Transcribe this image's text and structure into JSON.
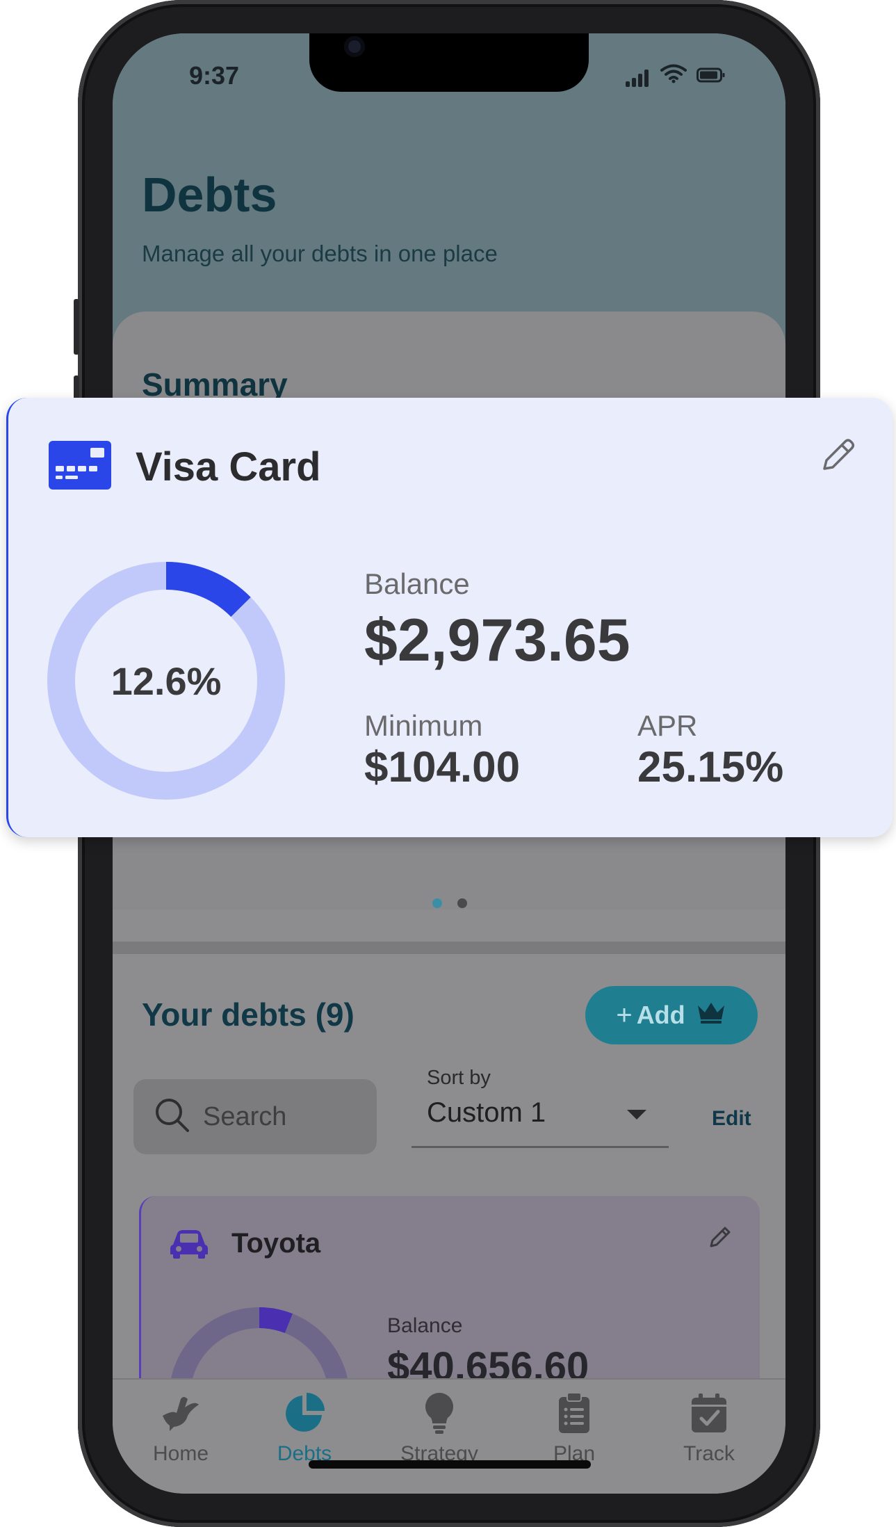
{
  "status": {
    "time": "9:37"
  },
  "header": {
    "title": "Debts",
    "subtitle": "Manage all your debts in one place"
  },
  "summary": {
    "title": "Summary",
    "carousel_pages": 2,
    "active_page": 1
  },
  "visa_card": {
    "name": "Visa Card",
    "icon": "credit-card-icon",
    "percent_label": "12.6%",
    "percent_value": 12.6,
    "balance_label": "Balance",
    "balance": "$2,973.65",
    "minimum_label": "Minimum",
    "minimum": "$104.00",
    "apr_label": "APR",
    "apr": "25.15%",
    "accent_color": "#2a46e8",
    "track_color": "#c0c9fa"
  },
  "debts_list": {
    "title": "Your debts (9)",
    "add_label": "Add",
    "search_placeholder": "Search",
    "sort_label": "Sort by",
    "sort_value": "Custom 1",
    "edit_label": "Edit",
    "items": [
      {
        "name": "Toyota",
        "icon": "car-icon",
        "balance_label": "Balance",
        "balance": "$40,656.60",
        "percent_value": 6
      }
    ]
  },
  "tabbar": {
    "items": [
      {
        "label": "Home",
        "icon": "dove-icon"
      },
      {
        "label": "Debts",
        "icon": "pie-chart-icon",
        "active": true
      },
      {
        "label": "Strategy",
        "icon": "lightbulb-icon"
      },
      {
        "label": "Plan",
        "icon": "clipboard-list-icon"
      },
      {
        "label": "Track",
        "icon": "calendar-check-icon"
      }
    ]
  },
  "colors": {
    "header_bg": "#647a80",
    "primary_teal": "#1f7f90",
    "overlay_gray": "#8d8d8f"
  }
}
